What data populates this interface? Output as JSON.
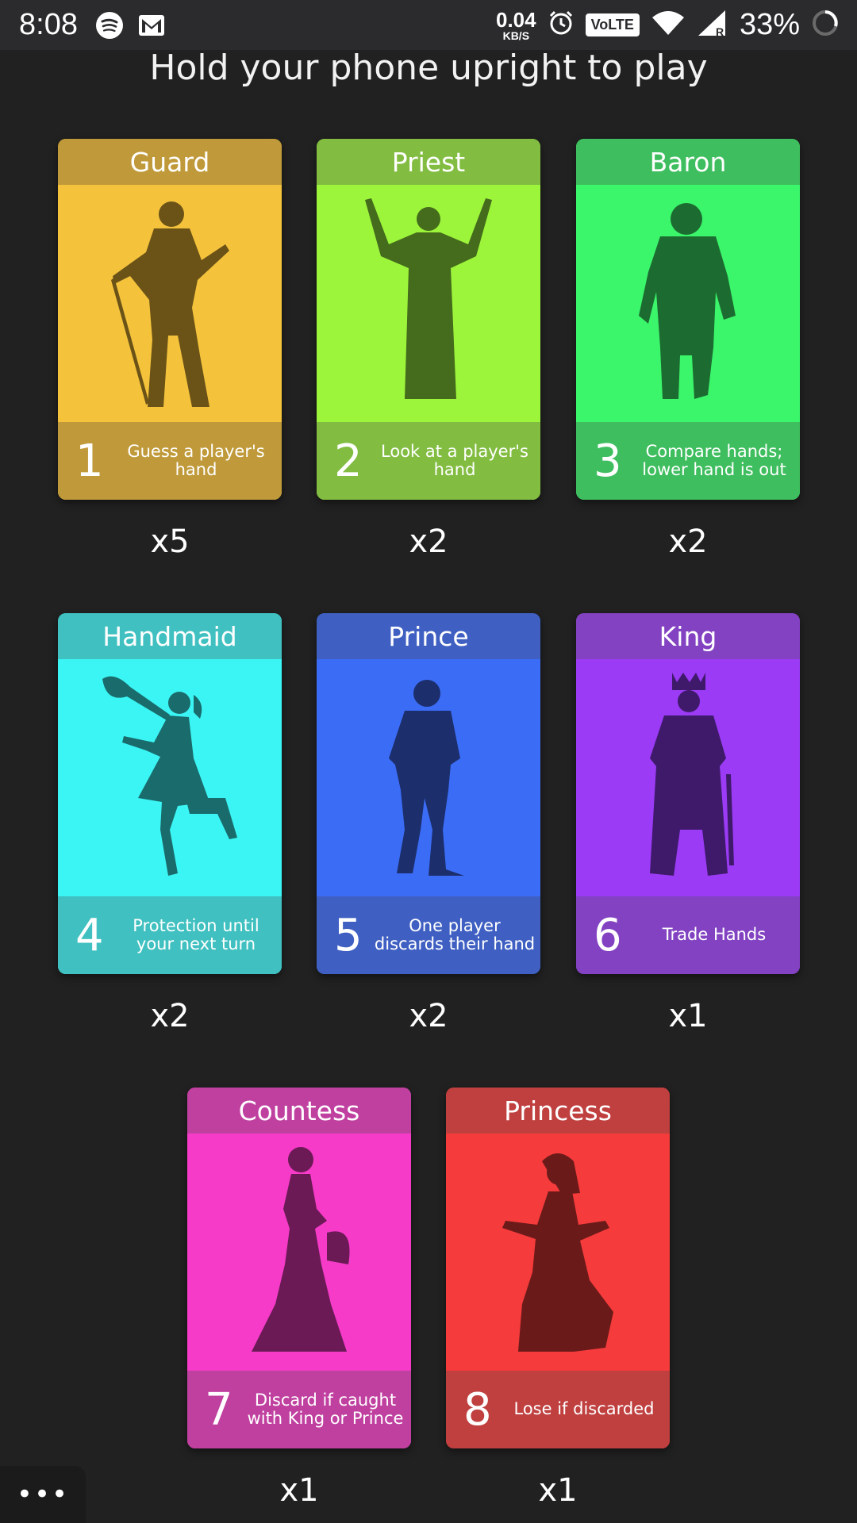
{
  "status_bar": {
    "time": "8:08",
    "net_speed": "0.04",
    "net_unit": "KB/S",
    "volte": "VoLTE",
    "battery": "33%"
  },
  "title": "Hold your phone upright to play",
  "cards": [
    {
      "name": "Guard",
      "number": "1",
      "description": "Guess a player's hand",
      "count": "x5",
      "head_color": "#c09a3a",
      "body_color": "#f5c33b",
      "silhouette_color": "#6b5318",
      "icon": "guard-icon"
    },
    {
      "name": "Priest",
      "number": "2",
      "description": "Look at a player's hand",
      "count": "x2",
      "head_color": "#82bd42",
      "body_color": "#9cf53b",
      "silhouette_color": "#456b1c",
      "icon": "priest-icon"
    },
    {
      "name": "Baron",
      "number": "3",
      "description": "Compare hands; lower hand is out",
      "count": "x2",
      "head_color": "#3ebe5e",
      "body_color": "#3bf56b",
      "silhouette_color": "#1c6b30",
      "icon": "baron-icon"
    },
    {
      "name": "Handmaid",
      "number": "4",
      "description": "Protection until your next turn",
      "count": "x2",
      "head_color": "#40c0c0",
      "body_color": "#3bf5f5",
      "silhouette_color": "#1a6b6b",
      "icon": "handmaid-icon"
    },
    {
      "name": "Prince",
      "number": "5",
      "description": "One player discards their hand",
      "count": "x2",
      "head_color": "#3f60c2",
      "body_color": "#3b6cf5",
      "silhouette_color": "#1c2e6b",
      "icon": "prince-icon"
    },
    {
      "name": "King",
      "number": "6",
      "description": "Trade Hands",
      "count": "x1",
      "head_color": "#8242c2",
      "body_color": "#9b3bf5",
      "silhouette_color": "#3f1a6b",
      "icon": "king-icon"
    },
    {
      "name": "Countess",
      "number": "7",
      "description": "Discard if caught with King or Prince",
      "count": "x1",
      "head_color": "#c040a0",
      "body_color": "#f53bc8",
      "silhouette_color": "#6b1a55",
      "icon": "countess-icon"
    },
    {
      "name": "Princess",
      "number": "8",
      "description": "Lose if discarded",
      "count": "x1",
      "head_color": "#c04040",
      "body_color": "#f53b3b",
      "silhouette_color": "#6b1a1a",
      "icon": "princess-icon"
    }
  ],
  "menu_label": "•••"
}
